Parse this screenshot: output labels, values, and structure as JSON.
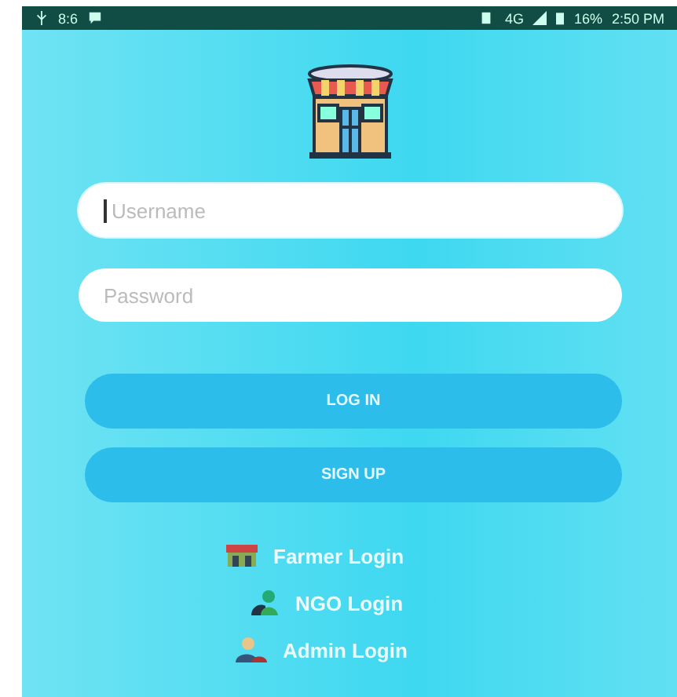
{
  "status_bar": {
    "left": "8:6",
    "network": "4G",
    "battery": "16%",
    "time": "2:50 PM"
  },
  "fields": [
    {
      "placeholder": "Username",
      "focused": true
    },
    {
      "placeholder": "Password",
      "focused": false
    }
  ],
  "buttons": [
    "LOG IN",
    "SIGN UP"
  ],
  "links": [
    {
      "label": "Farmer Login",
      "kind": "farmer"
    },
    {
      "label": "NGO Login",
      "kind": "ngo"
    },
    {
      "label": "Admin Login",
      "kind": "admin"
    }
  ]
}
